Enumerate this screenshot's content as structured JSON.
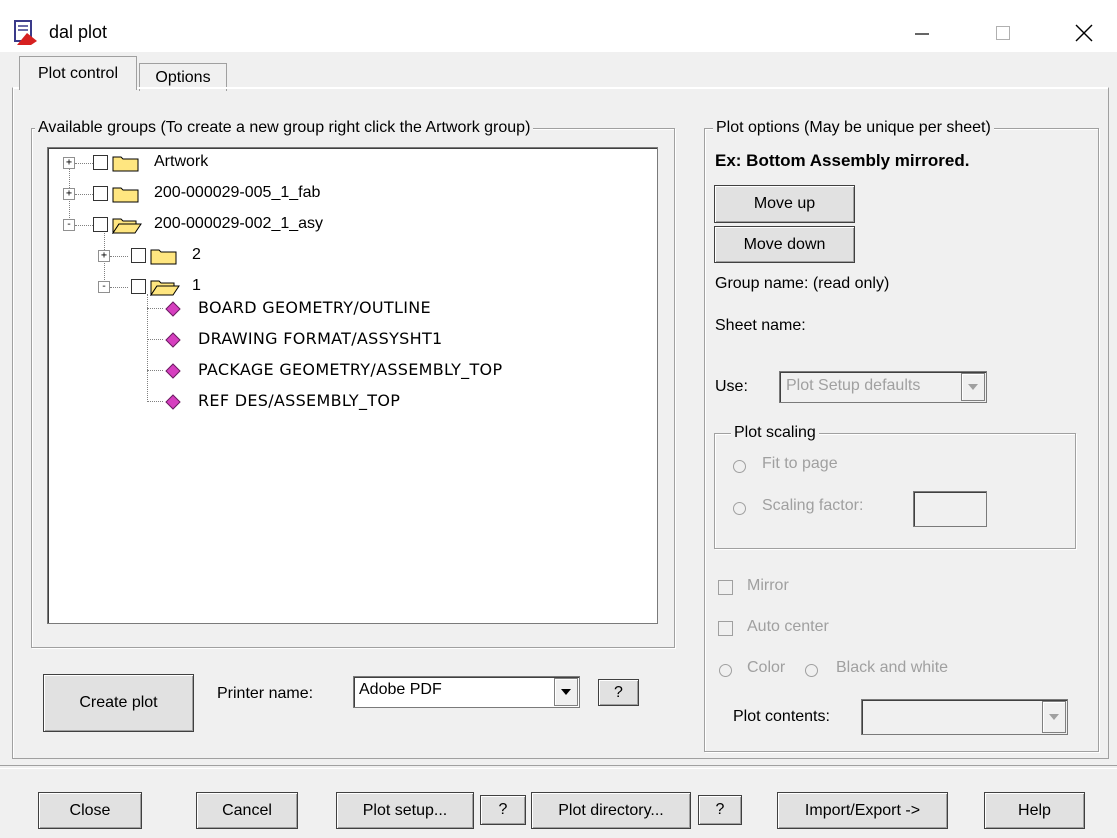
{
  "window": {
    "title": "dal plot",
    "minimize_icon": "minimize-icon",
    "maximize_icon": "maximize-icon",
    "close_icon": "close-icon"
  },
  "tabs": [
    {
      "label": "Plot control",
      "active": true
    },
    {
      "label": "Options",
      "active": false
    }
  ],
  "groups_panel": {
    "legend": "Available groups (To create a new group right click the Artwork group)",
    "tree": [
      {
        "label": "Artwork",
        "expander": "+",
        "folder": "closed"
      },
      {
        "label": "200-000029-005_1_fab",
        "expander": "+",
        "folder": "closed"
      },
      {
        "label": "200-000029-002_1_asy",
        "expander": "-",
        "folder": "open"
      },
      {
        "label": "2",
        "expander": "+",
        "folder": "closed"
      },
      {
        "label": "1",
        "expander": "-",
        "folder": "open"
      },
      {
        "label": "BOARD GEOMETRY/OUTLINE"
      },
      {
        "label": "DRAWING FORMAT/ASSYSHT1"
      },
      {
        "label": "PACKAGE GEOMETRY/ASSEMBLY_TOP"
      },
      {
        "label": "REF DES/ASSEMBLY_TOP"
      }
    ]
  },
  "plot_actions": {
    "create_label": "Create plot",
    "printer_label": "Printer name:",
    "printer_value": "Adobe PDF",
    "help_label": "?"
  },
  "plot_options": {
    "legend": "Plot options (May be unique per sheet)",
    "example": "Ex: Bottom Assembly mirrored.",
    "move_up": "Move up",
    "move_down": "Move down",
    "group_name": "Group name: (read only)",
    "sheet_name": "Sheet name:",
    "use_label": "Use:",
    "use_value": "Plot Setup defaults",
    "scaling": {
      "legend": "Plot scaling",
      "fit": "Fit to page",
      "factor": "Scaling factor:",
      "factor_value": ""
    },
    "mirror": "Mirror",
    "auto_center": "Auto center",
    "color": "Color",
    "bw": "Black and white",
    "contents_label": "Plot contents:",
    "contents_value": ""
  },
  "footer": {
    "close": "Close",
    "cancel": "Cancel",
    "plot_setup": "Plot setup...",
    "help1": "?",
    "plot_directory": "Plot directory...",
    "help2": "?",
    "import_export": "Import/Export ->",
    "help": "Help"
  },
  "colors": {
    "dialog_bg": "#f0f0f0",
    "folder": "#ffe680",
    "layer_icon": "#d63fbf",
    "disabled_text": "#a0a0a0"
  }
}
